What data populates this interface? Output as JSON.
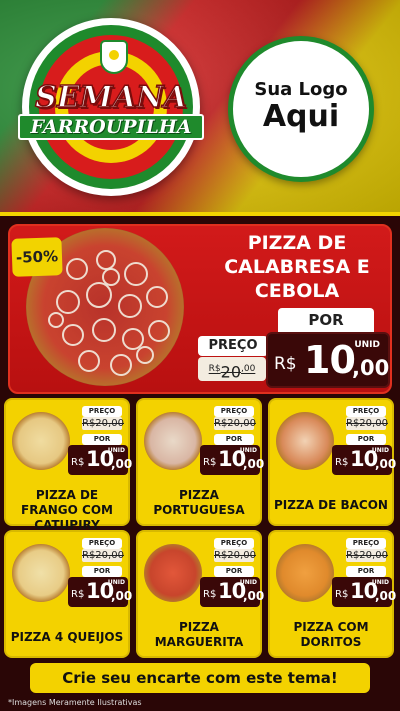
{
  "header": {
    "event_title_line1": "SEMANA",
    "event_title_line2": "FARROUPILHA",
    "logo_placeholder_line1": "Sua Logo",
    "logo_placeholder_line2": "Aqui",
    "crest_icon": "rs-coat-of-arms-icon"
  },
  "featured": {
    "discount": "-50%",
    "title_lines": [
      "PIZZA DE",
      "CALABRESA E",
      "CEBOLA"
    ],
    "preco_label": "PREÇO",
    "old_currency": "R$",
    "old_price": "20",
    "old_cents": ",00",
    "por_label": "POR",
    "currency": "R$",
    "price_int": "10",
    "price_dec": ",00",
    "unit": "UNID"
  },
  "cards": [
    {
      "name": "PIZZA DE FRANGO COM CATUPIRY",
      "preco_label": "PREÇO",
      "old_price": "R$20,00",
      "por_label": "POR",
      "currency": "R$",
      "price_int": "10",
      "price_dec": ",00",
      "unit": "UNID"
    },
    {
      "name": "PIZZA PORTUGUESA",
      "preco_label": "PREÇO",
      "old_price": "R$20,00",
      "por_label": "POR",
      "currency": "R$",
      "price_int": "10",
      "price_dec": ",00",
      "unit": "UNID"
    },
    {
      "name": "PIZZA DE BACON",
      "preco_label": "PREÇO",
      "old_price": "R$20,00",
      "por_label": "POR",
      "currency": "R$",
      "price_int": "10",
      "price_dec": ",00",
      "unit": "UNID"
    },
    {
      "name": "PIZZA 4 QUEIJOS",
      "preco_label": "PREÇO",
      "old_price": "R$20,00",
      "por_label": "POR",
      "currency": "R$",
      "price_int": "10",
      "price_dec": ",00",
      "unit": "UNID"
    },
    {
      "name": "PIZZA MARGUERITA",
      "preco_label": "PREÇO",
      "old_price": "R$20,00",
      "por_label": "POR",
      "currency": "R$",
      "price_int": "10",
      "price_dec": ",00",
      "unit": "UNID"
    },
    {
      "name": "PIZZA COM DORITOS",
      "preco_label": "PREÇO",
      "old_price": "R$20,00",
      "por_label": "POR",
      "currency": "R$",
      "price_int": "10",
      "price_dec": ",00",
      "unit": "UNID"
    }
  ],
  "cta": "Crie seu encarte com este tema!",
  "disclaimer": "*Imagens Meramente Ilustrativas",
  "colors": {
    "green": "#1f8a2c",
    "red": "#d21a1a",
    "yellow": "#f3d200",
    "dark_red": "#3a0808"
  }
}
